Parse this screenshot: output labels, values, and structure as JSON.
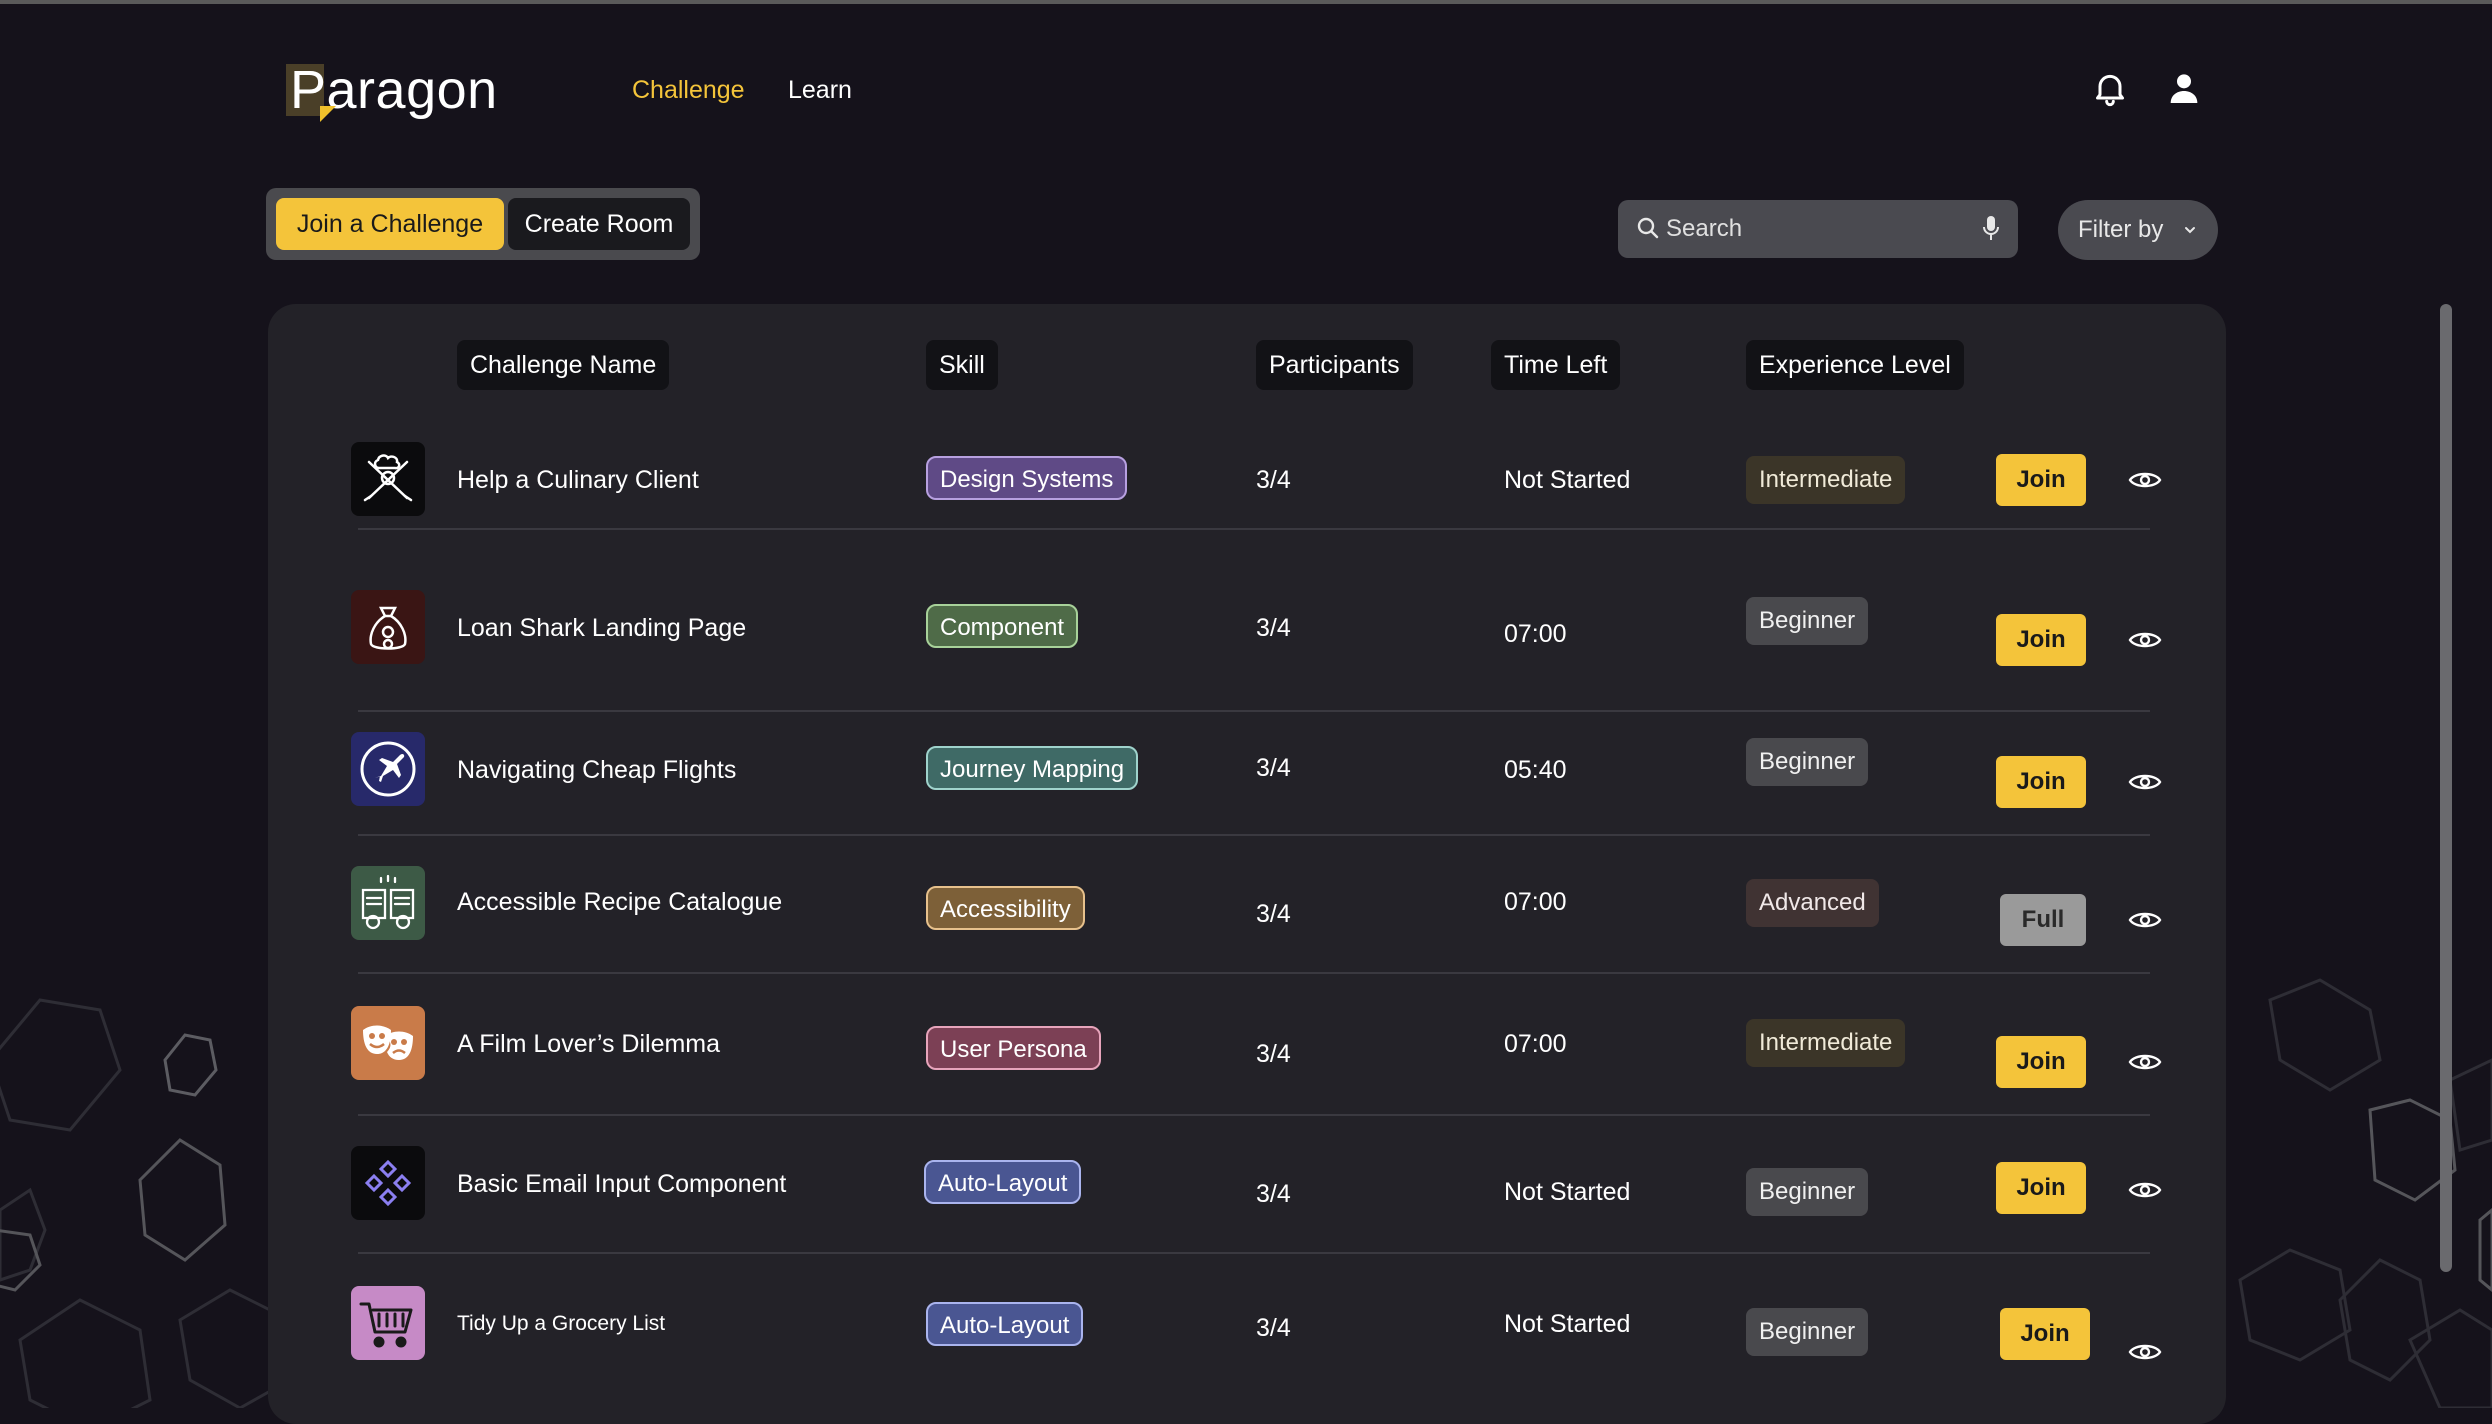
{
  "brand": {
    "name": "Paragon"
  },
  "nav": {
    "challenge": "Challenge",
    "learn": "Learn"
  },
  "toolbar": {
    "join_challenge": "Join a Challenge",
    "create_room": "Create Room",
    "search_placeholder": "Search",
    "filter_label": "Filter by"
  },
  "table": {
    "headers": {
      "name": "Challenge Name",
      "skill": "Skill",
      "participants": "Participants",
      "time_left": "Time Left",
      "level": "Experience Level"
    },
    "rows": [
      {
        "name": "Help a Culinary Client",
        "skill": "Design Systems",
        "participants": "3/4",
        "time_left": "Not Started",
        "level": "Intermediate",
        "action": "Join",
        "icon": "chef-icon"
      },
      {
        "name": "Loan Shark Landing Page",
        "skill": "Component",
        "participants": "3/4",
        "time_left": "07:00",
        "level": "Beginner",
        "action": "Join",
        "icon": "money-bag-icon"
      },
      {
        "name": "Navigating Cheap Flights",
        "skill": "Journey Mapping",
        "participants": "3/4",
        "time_left": "05:40",
        "level": "Beginner",
        "action": "Join",
        "icon": "airplane-icon"
      },
      {
        "name": "Accessible Recipe Catalogue",
        "skill": "Accessibility",
        "participants": "3/4",
        "time_left": "07:00",
        "level": "Advanced",
        "action": "Full",
        "icon": "recipe-book-icon"
      },
      {
        "name": "A Film Lover’s Dilemma",
        "skill": "User Persona",
        "participants": "3/4",
        "time_left": "07:00",
        "level": "Intermediate",
        "action": "Join",
        "icon": "theater-masks-icon"
      },
      {
        "name": "Basic Email Input Component",
        "skill": "Auto-Layout",
        "participants": "3/4",
        "time_left": "Not Started",
        "level": "Beginner",
        "action": "Join",
        "icon": "component-diamonds-icon"
      },
      {
        "name": "Tidy Up a Grocery List",
        "skill": "Auto-Layout",
        "participants": "3/4",
        "time_left": "Not Started",
        "level": "Beginner",
        "action": "Join",
        "icon": "shopping-cart-icon"
      }
    ]
  },
  "colors": {
    "accent": "#f4c43a",
    "background": "#15121b",
    "panel": "#232228",
    "skill_design_systems": "#5f4a86",
    "skill_component": "#4f6b48",
    "skill_journey_mapping": "#3f6a66",
    "skill_accessibility": "#7d6038",
    "skill_user_persona": "#7c4055",
    "skill_auto_layout": "#4a5692"
  }
}
